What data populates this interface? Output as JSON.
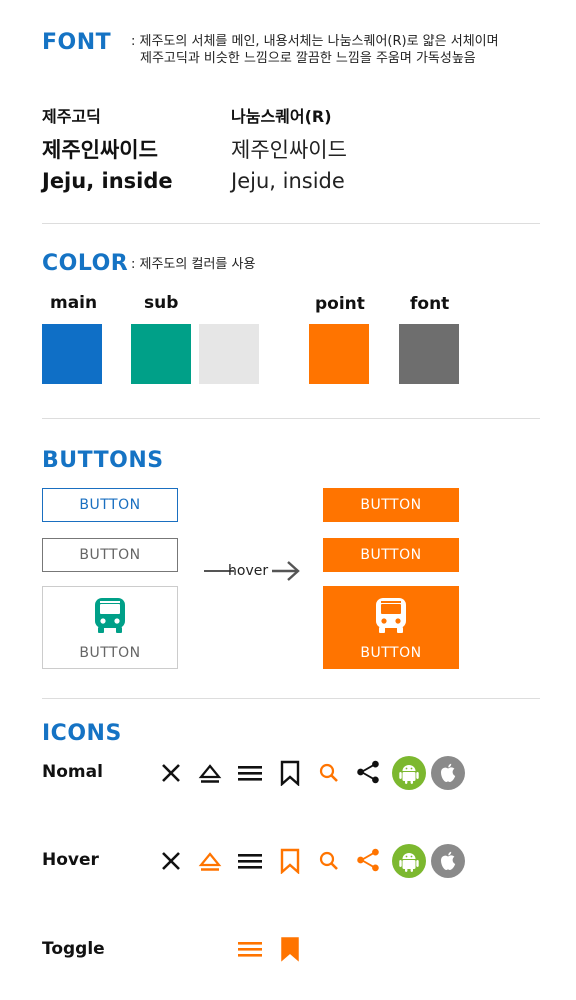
{
  "font": {
    "title": "FONT",
    "description_line1": ": 제주도의 서체를 메인, 내용서체는 나눔스퀘어(R)로 얇은 서체이며",
    "description_line2": "제주고딕과 비슷한 느낌으로 깔끔한 느낌을 주움며 가독성높음",
    "primary": {
      "name": "제주고딕",
      "sample_ko": "제주인싸이드",
      "sample_en": "Jeju, inside"
    },
    "secondary": {
      "name": "나눔스퀘어(R)",
      "sample_ko": "제주인싸이드",
      "sample_en": "Jeju, inside"
    }
  },
  "color": {
    "title": "COLOR",
    "description": ": 제주도의 컬러를 사용",
    "labels": {
      "main": "main",
      "sub": "sub",
      "point": "point",
      "font": "font"
    },
    "swatches": {
      "main": "#0f6fc6",
      "sub1": "#00a088",
      "sub2": "#e6e6e6",
      "point": "#ff7400",
      "font": "#6e6e6e"
    }
  },
  "buttons": {
    "title": "BUTTONS",
    "label": "BUTTON",
    "hover_label": "hover",
    "icons": {
      "bus": "bus-icon",
      "arrow": "arrow-right-icon"
    }
  },
  "icons": {
    "title": "ICONS",
    "rows": {
      "normal": "Nomal",
      "hover": "Hover",
      "toggle": "Toggle"
    },
    "set": [
      "close-icon",
      "eject-icon",
      "menu-icon",
      "bookmark-icon",
      "search-icon",
      "share-icon",
      "android-icon",
      "apple-icon"
    ],
    "colors": {
      "dark": "#111111",
      "orange": "#ff7400",
      "android": "#7cb82f",
      "apple": "#8a8a8a"
    }
  }
}
